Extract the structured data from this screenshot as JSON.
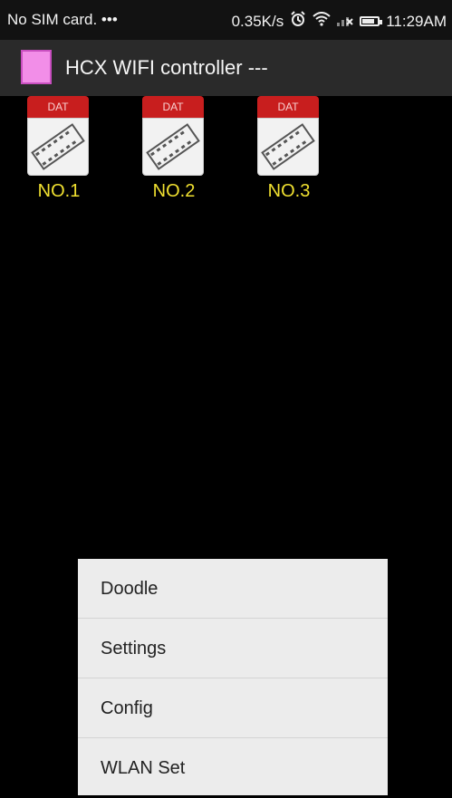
{
  "status_bar": {
    "carrier": "No SIM card. •••",
    "speed": "0.35K/s",
    "time": "11:29AM"
  },
  "action_bar": {
    "title": "HCX WIFI controller ---"
  },
  "files": [
    {
      "tag": "DAT",
      "label": "NO.1"
    },
    {
      "tag": "DAT",
      "label": "NO.2"
    },
    {
      "tag": "DAT",
      "label": "NO.3"
    }
  ],
  "menu": {
    "items": [
      "Doodle",
      "Settings",
      "Config",
      "WLAN Set"
    ]
  },
  "colors": {
    "accent_label": "#f0e030",
    "file_tag": "#c81e1e",
    "app_icon": "#f28ee8"
  }
}
